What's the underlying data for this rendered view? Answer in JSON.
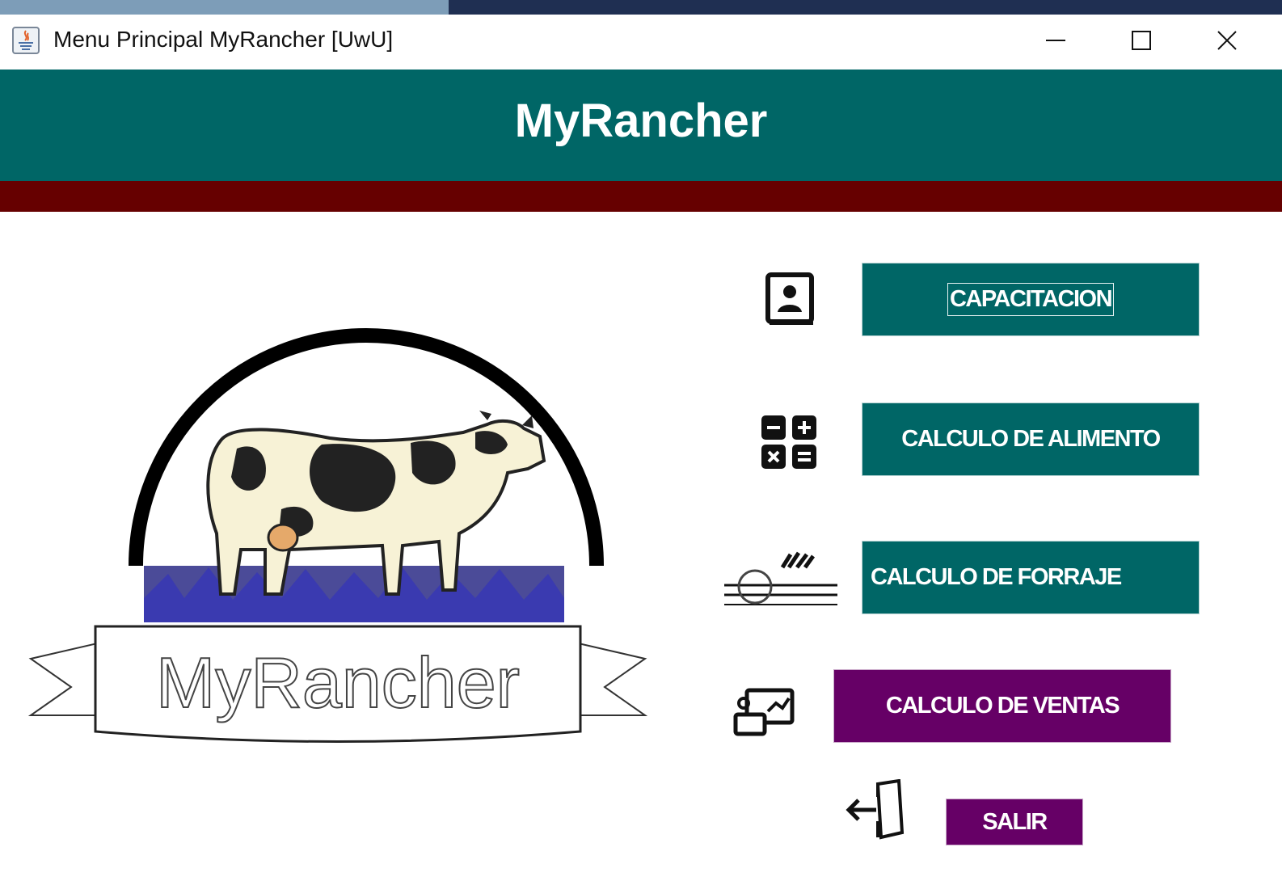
{
  "window": {
    "title": "Menu Principal MyRancher [UwU]",
    "controls": {
      "minimize_icon": "minimize-icon",
      "maximize_icon": "maximize-icon",
      "close_icon": "close-icon"
    }
  },
  "header": {
    "title": "MyRancher",
    "colors": {
      "header_bg": "#006666",
      "band_bg": "#660000"
    }
  },
  "logo": {
    "text": "MyRancher",
    "icon": "cow-logo"
  },
  "menu": {
    "items": [
      {
        "label": "CAPACITACION",
        "icon": "training-book-icon",
        "color": "#006666"
      },
      {
        "label": "CALCULO DE ALIMENTO",
        "icon": "calculator-icon",
        "color": "#006666"
      },
      {
        "label": "CALCULO DE FORRAJE",
        "icon": "forage-icon",
        "color": "#006666"
      },
      {
        "label": "CALCULO DE VENTAS",
        "icon": "sales-icon",
        "color": "#660066"
      },
      {
        "label": "SALIR",
        "icon": "exit-icon",
        "color": "#660066"
      }
    ]
  }
}
